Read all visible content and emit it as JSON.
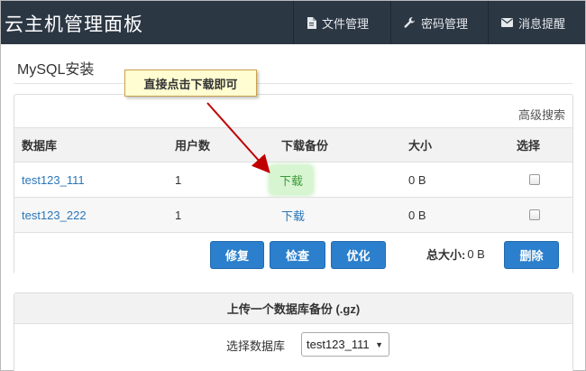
{
  "app": {
    "title": "云主机管理面板"
  },
  "nav": {
    "file_manage": "文件管理",
    "password_manage": "密码管理",
    "message_alert": "消息提醒"
  },
  "page": {
    "title": "MySQL安装"
  },
  "tooltip": {
    "text": "直接点击下载即可"
  },
  "panel": {
    "advanced_search": "高级搜索",
    "columns": {
      "database": "数据库",
      "users": "用户数",
      "download_backup": "下载备份",
      "size": "大小",
      "select": "选择"
    },
    "rows": [
      {
        "name": "test123_111",
        "users": "1",
        "download": "下载",
        "size": "0 B"
      },
      {
        "name": "test123_222",
        "users": "1",
        "download": "下载",
        "size": "0 B"
      }
    ],
    "buttons": {
      "repair": "修复",
      "check": "检查",
      "optimize": "优化",
      "delete": "删除"
    },
    "total_label": "总大小:",
    "total_value": "0 B"
  },
  "upload": {
    "title": "上传一个数据库备份 (.gz)",
    "select_label": "选择数据库",
    "selected": "test123_111"
  },
  "colors": {
    "topbar": "#2c3744",
    "accent": "#2b7fcc",
    "link": "#2a76b8",
    "highlight": "#d8f5d2",
    "tooltip_bg": "#fffdd1",
    "arrow": "#c00000"
  },
  "icons": {
    "file_manage": "document-icon",
    "password_manage": "wrench-icon",
    "message_alert": "envelope-icon"
  }
}
